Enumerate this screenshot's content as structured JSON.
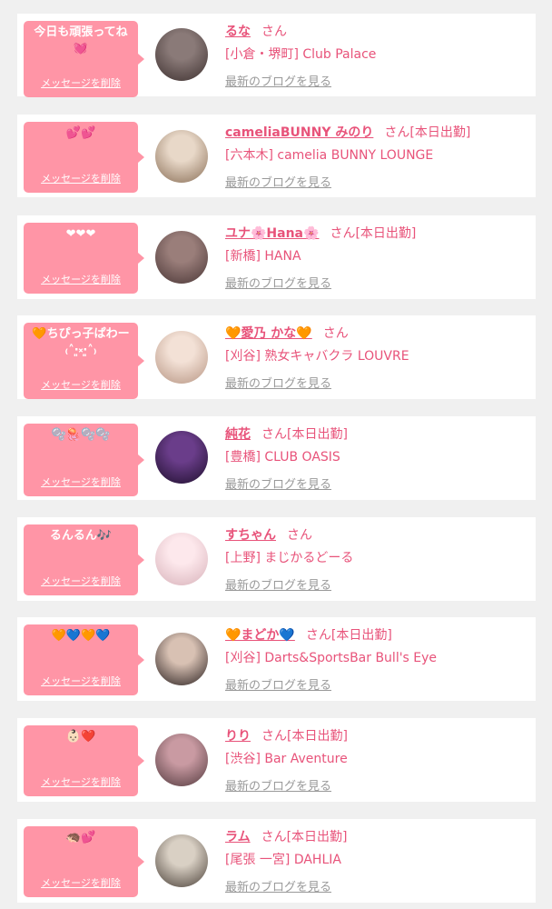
{
  "colors": {
    "accent": "#e8537a",
    "bubble": "#ff95a6",
    "link_gray": "#999999",
    "background": "#f0f0f0"
  },
  "common": {
    "delete_label": "メッセージを削除",
    "blog_label": "最新のブログを見る"
  },
  "items": [
    {
      "message": "今日も頑張ってね\n💓",
      "name": "るな",
      "honorific": "さん",
      "shop": "[小倉・堺町] Club Palace",
      "avatar_colors": [
        "#8a7a78",
        "#3e3130"
      ]
    },
    {
      "message": "💕💕",
      "name": "cameliaBUNNY みのり",
      "honorific": "さん[本日出勤]",
      "shop": "[六本木] camelia BUNNY LOUNGE",
      "avatar_colors": [
        "#e8d8c8",
        "#8a6f57"
      ]
    },
    {
      "message": "❤❤❤",
      "name": "ユナ🌸Hana🌸",
      "honorific": "さん[本日出勤]",
      "shop": "[新橋] HANA",
      "avatar_colors": [
        "#9a7e7a",
        "#4a3636"
      ]
    },
    {
      "message": "🧡ちぴっ子ぱわー\n₍˄·͈༝·͈˄₎",
      "name": "🧡愛乃 かな🧡",
      "honorific": "さん",
      "shop": "[刈谷] 熟女キャバクラ LOUVRE",
      "avatar_colors": [
        "#f3e1d6",
        "#b79583"
      ]
    },
    {
      "message": "🫧🪼🫧🫧",
      "name": "純花",
      "honorific": "さん[本日出勤]",
      "shop": "[豊橋] CLUB OASIS",
      "avatar_colors": [
        "#6a3d8a",
        "#1e0f2c"
      ]
    },
    {
      "message": "るんるん🎶",
      "name": "すちゃん",
      "honorific": "さん",
      "shop": "[上野] まじかるどーる",
      "avatar_colors": [
        "#fde8ec",
        "#d8b2ba"
      ]
    },
    {
      "message": "🧡💙🧡💙",
      "name": "🧡まどか💙",
      "honorific": "さん[本日出勤]",
      "shop": "[刈谷] Darts&SportsBar Bull's Eye",
      "avatar_colors": [
        "#d8c1b3",
        "#2a2020"
      ]
    },
    {
      "message": "👶🏻❤️",
      "name": "りり",
      "honorific": "さん[本日出勤]",
      "shop": "[渋谷] Bar Aventure",
      "avatar_colors": [
        "#c99aa2",
        "#533a3e"
      ]
    },
    {
      "message": "🦔💕",
      "name": "ラム",
      "honorific": "さん[本日出勤]",
      "shop": "[尾張 一宮] DAHLIA",
      "avatar_colors": [
        "#d9d0c4",
        "#4a4038"
      ]
    }
  ]
}
